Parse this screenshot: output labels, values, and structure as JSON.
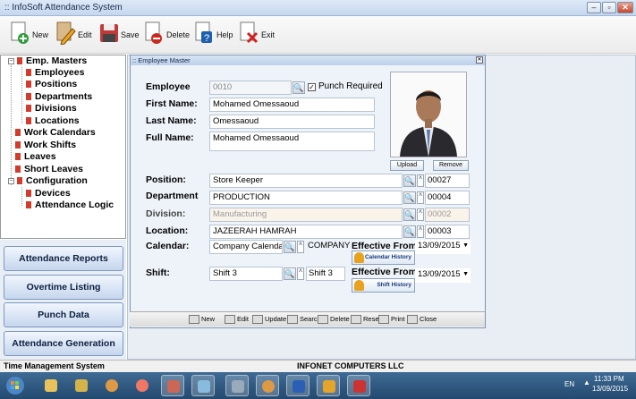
{
  "window": {
    "title": ":: InfoSoft Attendance System"
  },
  "toolbar": {
    "items": [
      {
        "label": "New",
        "icon": "new-doc-icon"
      },
      {
        "label": "Edit",
        "icon": "edit-pencil-icon"
      },
      {
        "label": "Save",
        "icon": "save-icon"
      },
      {
        "label": "Delete",
        "icon": "delete-icon"
      },
      {
        "label": "Help",
        "icon": "help-icon"
      },
      {
        "label": "Exit",
        "icon": "exit-icon"
      }
    ]
  },
  "tree": {
    "emp_masters": "Emp. Masters",
    "employees": "Employees",
    "positions": "Positions",
    "departments": "Departments",
    "divisions": "Divisions",
    "locations": "Locations",
    "work_calendars": "Work Calendars",
    "work_shifts": "Work Shifts",
    "leaves": "Leaves",
    "short_leaves": "Short Leaves",
    "configuration": "Configuration",
    "devices": "Devices",
    "attendance_logic": "Attendance Logic"
  },
  "nav": {
    "attendance_reports": "Attendance Reports",
    "overtime_listing": "Overtime Listing",
    "punch_data": "Punch Data",
    "attendance_generation": "Attendance Generation"
  },
  "form": {
    "title": ":: Employee Master",
    "labels": {
      "employee": "Employee",
      "first_name": "First Name:",
      "last_name": "Last Name:",
      "full_name": "Full Name:",
      "position": "Position:",
      "department": "Department",
      "division": "Division:",
      "location": "Location:",
      "calendar": "Calendar:",
      "shift": "Shift:",
      "effective_from": "Effective From:",
      "punch_required": "Punch Required"
    },
    "values": {
      "employee_id": "0010",
      "first_name": "Mohamed Omessaoud",
      "last_name": "Omessaoud",
      "full_name": "Mohamed Omessaoud",
      "position": "Store Keeper",
      "position_code": "00027",
      "department": "PRODUCTION",
      "department_code": "00004",
      "division": "Manufacturing",
      "division_code": "00002",
      "location": "JAZEERAH HAMRAH",
      "location_code": "00003",
      "calendar": "Company Calendar",
      "calendar_code": "COMPANY",
      "calendar_date": "13/09/2015",
      "shift": "Shift 3",
      "shift_code": "Shift 3",
      "shift_date": "13/09/2015",
      "punch_required": true
    },
    "buttons": {
      "upload": "Upload",
      "remove": "Remove",
      "calendar_history": "Calendar History",
      "shift_history": "Shift History"
    },
    "bottom": {
      "new": "New",
      "edit": "Edit",
      "update": "Update",
      "search": "Search",
      "delete": "Delete",
      "reset": "Reset",
      "print": "Print",
      "close": "Close"
    }
  },
  "status": {
    "left": "Time Management System",
    "center": "INFONET COMPUTERS LLC"
  },
  "taskbar": {
    "lang": "EN",
    "time": "11:33 PM",
    "date": "13/09/2015"
  }
}
